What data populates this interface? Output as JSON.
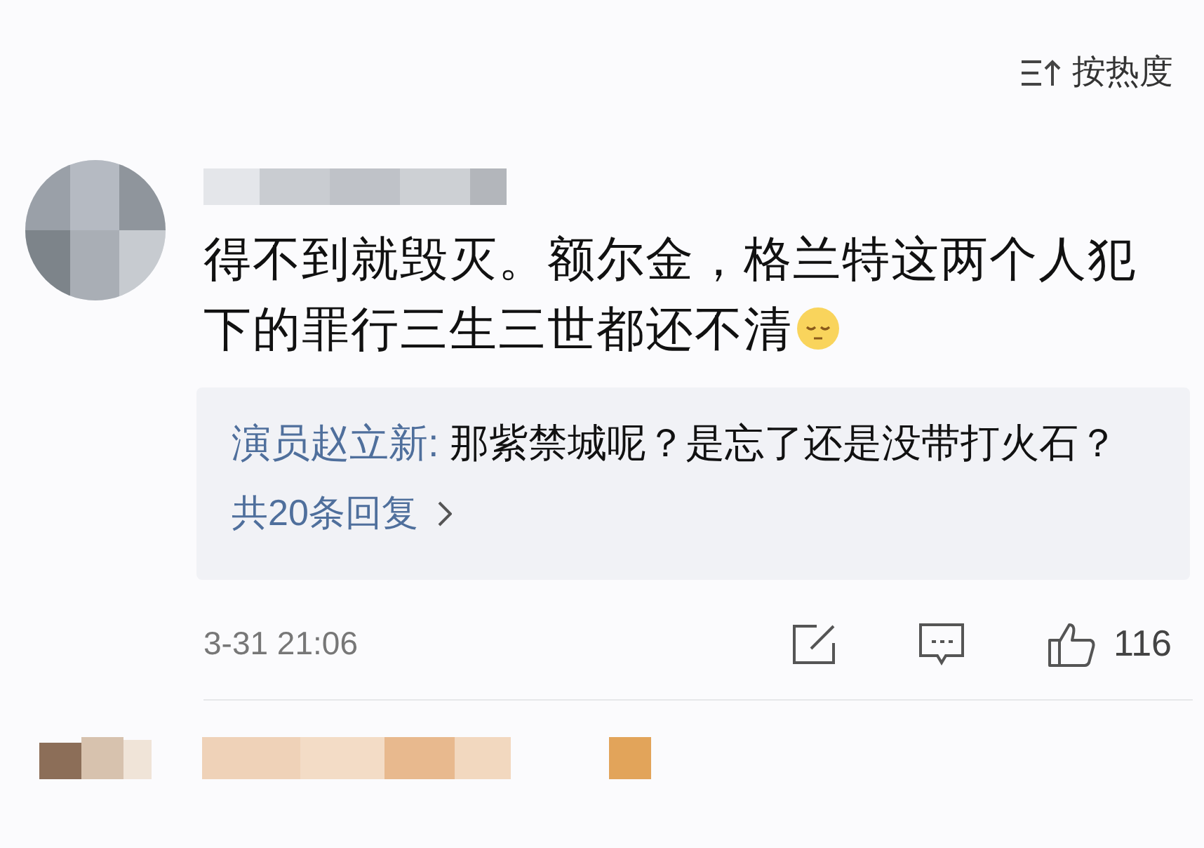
{
  "sort": {
    "label": "按热度"
  },
  "comment": {
    "text": "得不到就毁灭。额尔金，格兰特这两个人犯下的罪行三生三世都还不清",
    "reply": {
      "author": "演员赵立新:",
      "text": "那紫禁城呢？是忘了还是没带打火石？",
      "more": "共20条回复"
    },
    "time": "3-31 21:06",
    "likes": "116"
  }
}
